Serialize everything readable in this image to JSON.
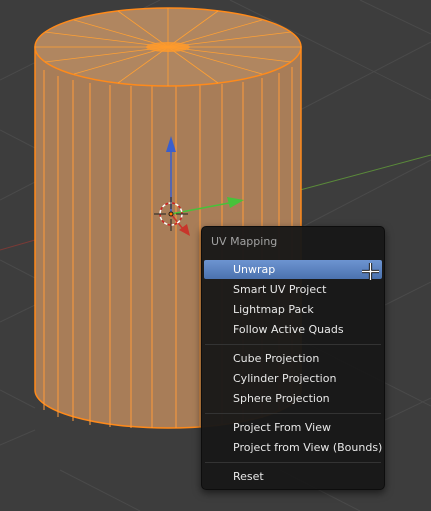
{
  "menu": {
    "title": "UV Mapping",
    "items": [
      {
        "label": "Unwrap",
        "state": "highlighted"
      },
      {
        "label": "Smart UV Project"
      },
      {
        "label": "Lightmap Pack"
      },
      {
        "label": "Follow Active Quads"
      },
      {
        "label": "Cube Projection"
      },
      {
        "label": "Cylinder Projection"
      },
      {
        "label": "Sphere Projection"
      },
      {
        "label": "Project From View"
      },
      {
        "label": "Project from View (Bounds)"
      },
      {
        "label": "Reset"
      }
    ]
  },
  "colors": {
    "viewport_background": "#3d3d3d",
    "grid_line": "#4a4a4a",
    "mesh_face": "#a87d58",
    "mesh_edge": "#ffa033",
    "gizmo_x": "#c8352b",
    "gizmo_y": "#47c23a",
    "gizmo_z": "#3a5fcd",
    "menu_background": "#181818",
    "menu_highlight": "#5680c2"
  }
}
